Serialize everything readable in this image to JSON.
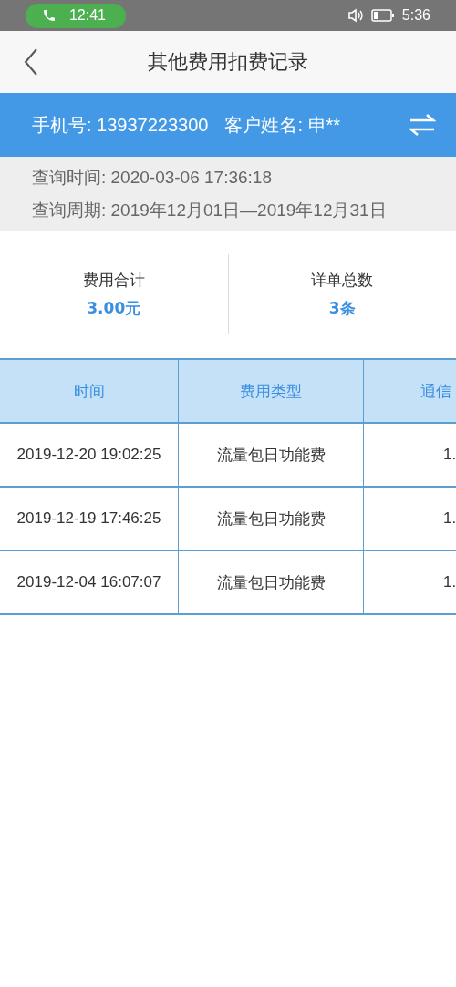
{
  "status_bar": {
    "call_time": "12:41",
    "clock": "5:36"
  },
  "nav": {
    "title": "其他费用扣费记录"
  },
  "customer": {
    "phone": "手机号: 13937223300",
    "name": "客户姓名: 申**"
  },
  "query": {
    "time": "查询时间: 2020-03-06 17:36:18",
    "period": "查询周期: 2019年12月01日—2019年12月31日"
  },
  "summary": [
    {
      "label": "费用合计",
      "value": "3.00元"
    },
    {
      "label": "详单总数",
      "value": "3条"
    }
  ],
  "table": {
    "columns": [
      "时间",
      "费用类型",
      "通信"
    ],
    "rows": [
      [
        "2019-12-20 19:02:25",
        "流量包日功能费",
        "1."
      ],
      [
        "2019-12-19 17:46:25",
        "流量包日功能费",
        "1."
      ],
      [
        "2019-12-04 16:07:07",
        "流量包日功能费",
        "1."
      ]
    ]
  }
}
